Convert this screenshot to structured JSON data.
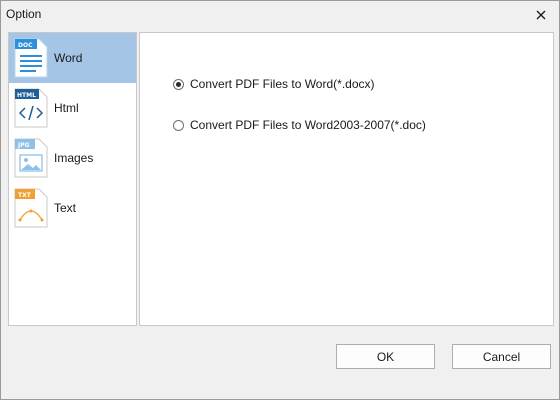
{
  "window": {
    "title": "Option"
  },
  "sidebar": {
    "items": [
      {
        "label": "Word",
        "badge": "DOC",
        "selected": true
      },
      {
        "label": "Html",
        "badge": "HTML",
        "selected": false
      },
      {
        "label": "Images",
        "badge": "JPG",
        "selected": false
      },
      {
        "label": "Text",
        "badge": "TXT",
        "selected": false
      }
    ]
  },
  "options": [
    {
      "label": "Convert PDF Files to Word(*.docx)",
      "checked": true
    },
    {
      "label": "Convert PDF Files to Word2003-2007(*.doc)",
      "checked": false
    }
  ],
  "buttons": {
    "ok": "OK",
    "cancel": "Cancel"
  },
  "colors": {
    "selected_bg": "#a4c5e5",
    "doc_badge": "#2b8fd9",
    "html_badge": "#1f5e99",
    "jpg_badge": "#8fc1e8",
    "txt_badge": "#f0a030"
  }
}
